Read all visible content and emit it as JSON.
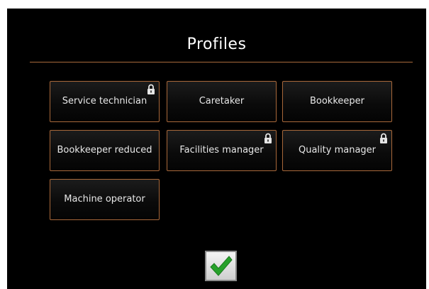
{
  "header": {
    "title": "Profiles"
  },
  "profiles": [
    {
      "label": "Service technician",
      "locked": true
    },
    {
      "label": "Caretaker",
      "locked": false
    },
    {
      "label": "Bookkeeper",
      "locked": false
    },
    {
      "label": "Bookkeeper reduced",
      "locked": false
    },
    {
      "label": "Facilities manager",
      "locked": true
    },
    {
      "label": "Quality manager",
      "locked": true
    },
    {
      "label": "Machine operator",
      "locked": false
    }
  ],
  "icons": {
    "lock": "lock-icon",
    "confirm": "checkmark-icon"
  },
  "colors": {
    "background": "#000000",
    "accent_border": "#a8683a",
    "confirm_check": "#27a12a"
  }
}
